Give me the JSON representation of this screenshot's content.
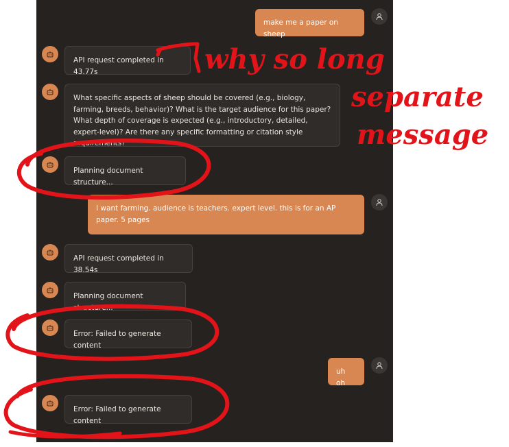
{
  "messages": [
    {
      "role": "user",
      "text": "make me a paper on sheep"
    },
    {
      "role": "bot",
      "text": "API request completed in 43.77s"
    },
    {
      "role": "bot",
      "text": "What specific aspects of sheep should be covered (e.g., biology, farming, breeds, behavior)? What is the target audience for this paper? What depth of coverage is expected (e.g., introductory, detailed, expert-level)? Are there any specific formatting or citation style requirements?"
    },
    {
      "role": "bot",
      "text": "Planning document structure..."
    },
    {
      "role": "user",
      "text": "I want farming. audience is teachers. expert level. this is for an AP paper. 5 pages"
    },
    {
      "role": "bot",
      "text": "API request completed in 38.54s"
    },
    {
      "role": "bot",
      "text": "Planning document structure..."
    },
    {
      "role": "bot",
      "text": "Error: Failed to generate content"
    },
    {
      "role": "user",
      "text": "uh oh"
    },
    {
      "role": "bot",
      "text": "Error: Failed to generate content"
    }
  ],
  "annotations": {
    "line1": "why so long",
    "line2": "separate",
    "line3": "message"
  },
  "colors": {
    "panel_bg": "#26221f",
    "bot_bubble": "#302c29",
    "user_bubble": "#d98752",
    "bot_avatar": "#d98752",
    "user_avatar": "#3a3633",
    "annotation_red": "#e2141a"
  }
}
